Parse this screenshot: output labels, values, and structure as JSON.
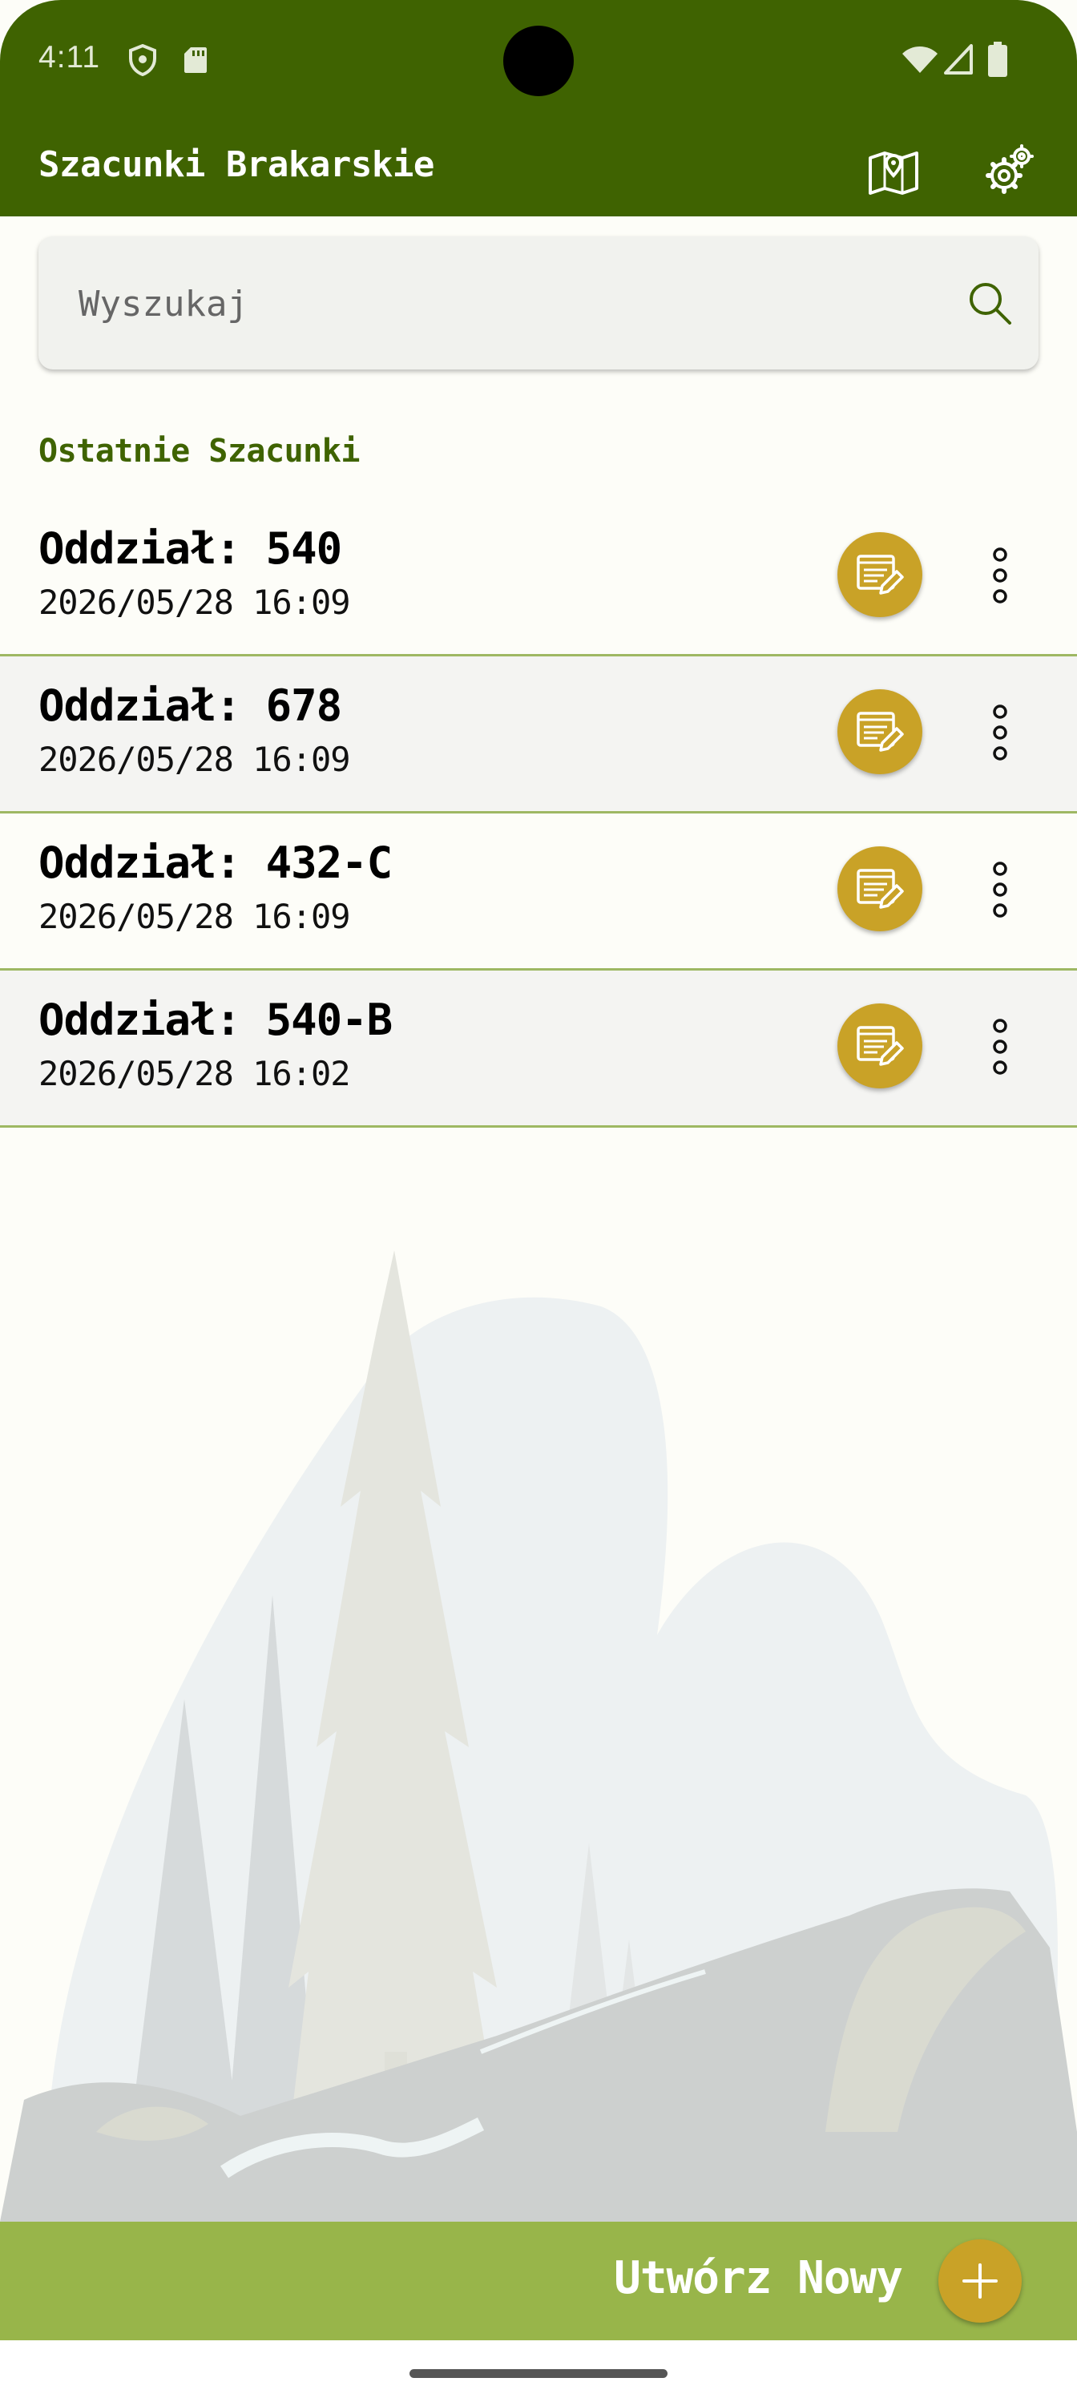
{
  "status_bar": {
    "time": "4:11",
    "icons_left": [
      "shield-icon",
      "sd-card-icon"
    ],
    "icons_right": [
      "wifi-icon",
      "signal-icon",
      "battery-icon"
    ]
  },
  "app_bar": {
    "title": "Szacunki Brakarskie",
    "actions": [
      "map-icon",
      "settings-icon"
    ]
  },
  "search": {
    "placeholder": "Wyszukaj",
    "value": ""
  },
  "section": {
    "title": "Ostatnie Szacunki"
  },
  "estimates": [
    {
      "title": "Oddział: 540",
      "date": "2026/05/28 16:09"
    },
    {
      "title": "Oddział: 678",
      "date": "2026/05/28 16:09"
    },
    {
      "title": "Oddział: 432-C",
      "date": "2026/05/28 16:09"
    },
    {
      "title": "Oddział: 540-B",
      "date": "2026/05/28 16:02"
    }
  ],
  "bottom_bar": {
    "create_label": "Utwórz Nowy"
  },
  "colors": {
    "primary": "#3F6301",
    "accent": "#C9A227",
    "bottom_bar": "#98B54A",
    "divider": "#9EB863",
    "background": "#FDFDF8"
  }
}
